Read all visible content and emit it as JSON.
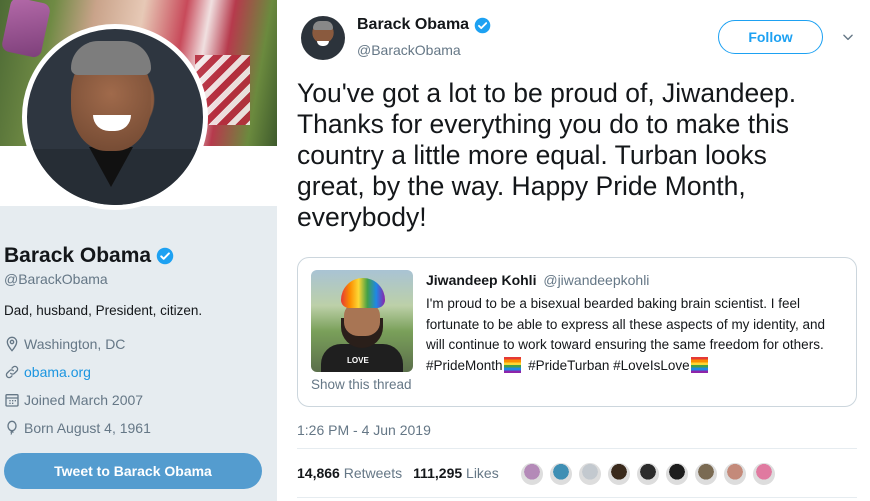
{
  "profile": {
    "name": "Barack Obama",
    "handle": "@BarackObama",
    "bio": "Dad, husband, President, citizen.",
    "location": "Washington, DC",
    "website": "obama.org",
    "joined": "Joined March 2007",
    "born": "Born August 4, 1961",
    "tweet_to_label": "Tweet to Barack Obama"
  },
  "tweet": {
    "author_name": "Barack Obama",
    "author_handle": "@BarackObama",
    "follow_label": "Follow",
    "text": "You've got a lot to be proud of, Jiwandeep.\nThanks for everything you do to make this\ncountry a little more equal. Turban looks\ngreat, by the way. Happy Pride Month,\neverybody!",
    "timestamp": "1:26 PM - 4 Jun 2019",
    "retweets_count": "14,866",
    "retweets_label": "Retweets",
    "likes_count": "111,295",
    "likes_label": "Likes"
  },
  "quoted": {
    "name": "Jiwandeep Kohli",
    "handle": "@jiwandeepkohli",
    "text": "I'm proud to be a bisexual bearded baking brain scientist. I feel fortunate to be able to express all these aspects of my identity, and will continue to work toward ensuring the same freedom for others.",
    "hashtag1": "#PrideMonth",
    "hashtag2": "#PrideTurban",
    "hashtag3": "#LoveIsLove",
    "image_caption": "LOVE",
    "show_thread": "Show this thread"
  },
  "colors": {
    "accent": "#1da1f2",
    "link": "#1b95e0",
    "tweet_to_button": "#549ccf",
    "secondary_text": "#657786",
    "sidebar_bg": "#e6ecf0"
  },
  "likers": [
    {
      "color": "#b48ab8"
    },
    {
      "color": "#3f8fb4"
    },
    {
      "color": "#c3c9cf"
    },
    {
      "color": "#3a2a1c"
    },
    {
      "color": "#2b2b2b"
    },
    {
      "color": "#1d1d1d"
    },
    {
      "color": "#7a6a52"
    },
    {
      "color": "#c48a7a"
    },
    {
      "color": "#e07aa0"
    }
  ]
}
